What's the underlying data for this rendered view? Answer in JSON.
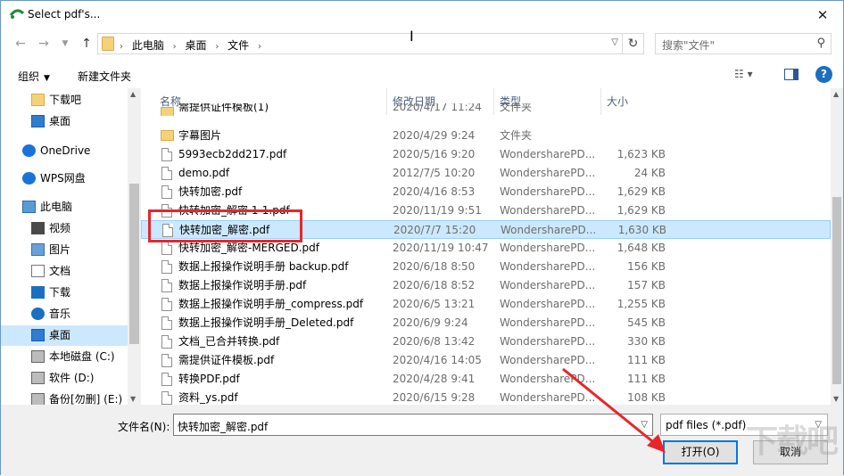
{
  "window": {
    "title": "Select pdf's...",
    "close_icon": "close-icon"
  },
  "address": {
    "crumbs": [
      "此电脑",
      "桌面",
      "文件"
    ],
    "search_placeholder": "搜索\"文件\""
  },
  "toolbar": {
    "organize": "组织",
    "new_folder": "新建文件夹"
  },
  "nav": [
    {
      "label": "下载吧",
      "icon": "folder-icon"
    },
    {
      "label": "桌面",
      "icon": "desktop-icon"
    },
    {
      "label": "OneDrive",
      "icon": "cloud-icon"
    },
    {
      "label": "WPS网盘",
      "icon": "cloud-icon"
    },
    {
      "label": "此电脑",
      "icon": "computer-icon"
    },
    {
      "label": "视频",
      "icon": "video-icon"
    },
    {
      "label": "图片",
      "icon": "image-icon"
    },
    {
      "label": "文档",
      "icon": "document-icon"
    },
    {
      "label": "下载",
      "icon": "download-icon"
    },
    {
      "label": "音乐",
      "icon": "music-icon"
    },
    {
      "label": "桌面",
      "icon": "desktop-icon",
      "selected": true
    },
    {
      "label": "本地磁盘 (C:)",
      "icon": "drive-icon"
    },
    {
      "label": "软件 (D:)",
      "icon": "drive-icon"
    },
    {
      "label": "备份[勿删] (E:)",
      "icon": "drive-icon"
    }
  ],
  "columns": {
    "name": "名称",
    "date": "修改日期",
    "type": "类型",
    "size": "大小"
  },
  "files": [
    {
      "name": "需提供证件模板(1)",
      "date": "2020/4/17 11:24",
      "type": "文件夹",
      "size": "",
      "kind": "folder"
    },
    {
      "name": "字幕图片",
      "date": "2020/4/29 9:24",
      "type": "文件夹",
      "size": "",
      "kind": "folder"
    },
    {
      "name": "5993ecb2dd217.pdf",
      "date": "2020/5/16 9:20",
      "type": "WondersharePD...",
      "size": "1,623 KB",
      "kind": "file"
    },
    {
      "name": "demo.pdf",
      "date": "2012/7/5 10:20",
      "type": "WondersharePD...",
      "size": "24 KB",
      "kind": "file"
    },
    {
      "name": "快转加密.pdf",
      "date": "2020/4/16 8:53",
      "type": "WondersharePD...",
      "size": "1,629 KB",
      "kind": "file"
    },
    {
      "name": "快转加密_解密 1-1.pdf",
      "date": "2020/11/19 9:51",
      "type": "WondersharePD...",
      "size": "1,629 KB",
      "kind": "file"
    },
    {
      "name": "快转加密_解密.pdf",
      "date": "2020/7/7 15:20",
      "type": "WondersharePD...",
      "size": "1,630 KB",
      "kind": "file",
      "selected": true
    },
    {
      "name": "快转加密_解密-MERGED.pdf",
      "date": "2020/11/19 10:47",
      "type": "WondersharePD...",
      "size": "1,648 KB",
      "kind": "file"
    },
    {
      "name": "数据上报操作说明手册 backup.pdf",
      "date": "2020/6/18 8:50",
      "type": "WondersharePD...",
      "size": "156 KB",
      "kind": "file"
    },
    {
      "name": "数据上报操作说明手册.pdf",
      "date": "2020/6/18 8:52",
      "type": "WondersharePD...",
      "size": "157 KB",
      "kind": "file"
    },
    {
      "name": "数据上报操作说明手册_compress.pdf",
      "date": "2020/6/5 13:21",
      "type": "WondersharePD...",
      "size": "1,255 KB",
      "kind": "file"
    },
    {
      "name": "数据上报操作说明手册_Deleted.pdf",
      "date": "2020/6/9 9:24",
      "type": "WondersharePD...",
      "size": "545 KB",
      "kind": "file"
    },
    {
      "name": "文档_已合并转换.pdf",
      "date": "2020/6/8 13:42",
      "type": "WondersharePD...",
      "size": "330 KB",
      "kind": "file"
    },
    {
      "name": "需提供证件模板.pdf",
      "date": "2020/4/16 14:05",
      "type": "WondersharePD...",
      "size": "111 KB",
      "kind": "file"
    },
    {
      "name": "转换PDF.pdf",
      "date": "2020/4/28 9:41",
      "type": "WondersharePD...",
      "size": "111 KB",
      "kind": "file"
    },
    {
      "name": "资料_ys.pdf",
      "date": "2020/6/15 9:28",
      "type": "WondersharePD...",
      "size": "108 KB",
      "kind": "file"
    }
  ],
  "bottom": {
    "filename_label": "文件名(N):",
    "filename_value": "快转加密_解密.pdf",
    "filetype": "pdf files (*.pdf)",
    "open": "打开(O)",
    "cancel": "取消"
  },
  "colors": {
    "selection": "#cce8ff",
    "highlight": "#e8262a",
    "accent": "#0078d7"
  }
}
